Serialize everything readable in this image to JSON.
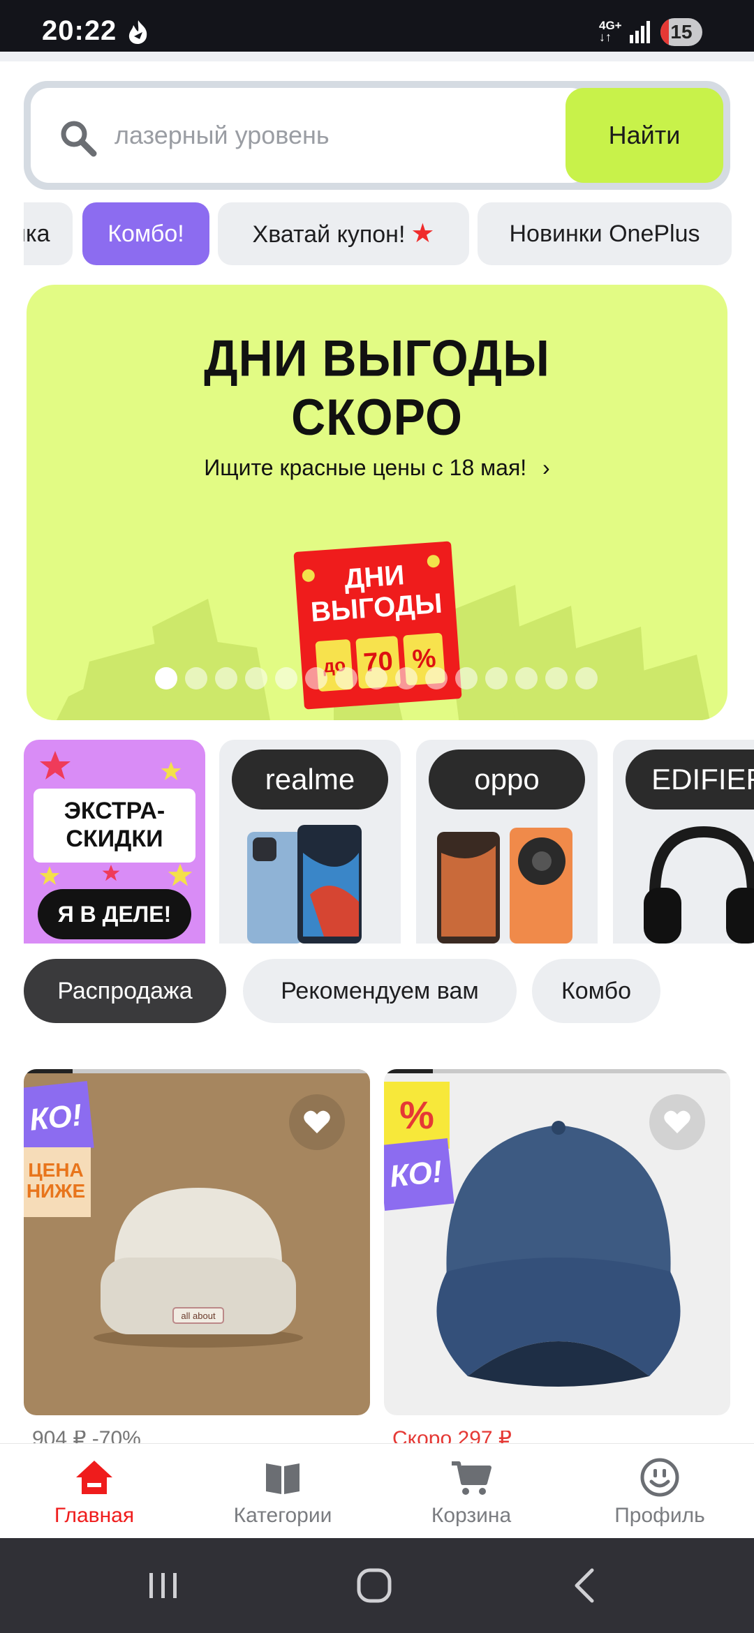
{
  "status_bar": {
    "time": "20:22",
    "network": "4G+",
    "battery": "15"
  },
  "search": {
    "placeholder": "лазерный уровень",
    "button_label": "Найти"
  },
  "quick_chips": [
    {
      "label": "ика"
    },
    {
      "label": "Комбо!"
    },
    {
      "label": "Хватай купон!"
    },
    {
      "label": "Новинки OnePlus"
    }
  ],
  "banner": {
    "title_line1": "ДНИ ВЫГОДЫ",
    "title_line2": "СКОРО",
    "subtitle": "Ищите красные цены с 18 мая!",
    "badge_line1": "ДНИ",
    "badge_line2": "ВЫГОДЫ",
    "badge_box1": "до",
    "badge_box2": "70",
    "badge_box3": "%",
    "total_slides": 15,
    "active_slide": 1
  },
  "brands": {
    "extra_line1": "ЭКСТРА-",
    "extra_line2": "СКИДКИ",
    "extra_button": "Я В ДЕЛЕ!",
    "items": [
      "realme",
      "oppo",
      "EDIFIER"
    ]
  },
  "section_tabs": [
    {
      "label": "Распродажа"
    },
    {
      "label": "Рекомендуем вам"
    },
    {
      "label": "Комбо"
    }
  ],
  "products": [
    {
      "stickers": [
        "КО!",
        "ЦЕНА",
        "НИЖЕ"
      ],
      "hat_label": "all about",
      "price_text": "904 ₽ -70%"
    },
    {
      "stickers": [
        "%",
        "КО!"
      ],
      "price_text": "Скоро 297 ₽"
    }
  ],
  "bottom_nav": [
    {
      "label": "Главная"
    },
    {
      "label": "Категории"
    },
    {
      "label": "Корзина"
    },
    {
      "label": "Профиль"
    }
  ],
  "colors": {
    "accent_green": "#c8f24a",
    "banner_green": "#e2fb84",
    "combo_purple": "#8c6cf0",
    "brand_red": "#ef1c1c"
  }
}
